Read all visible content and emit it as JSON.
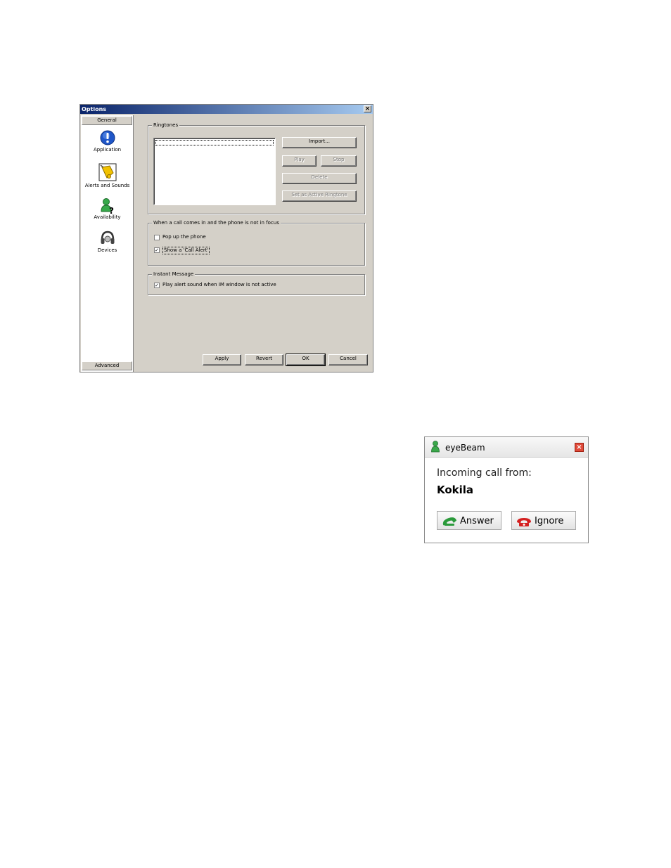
{
  "options": {
    "title": "Options",
    "sidebar": {
      "top_header": "General",
      "bottom_header": "Advanced",
      "items": [
        {
          "label": "Application",
          "icon": "info-icon"
        },
        {
          "label": "Alerts and Sounds",
          "icon": "bell-icon"
        },
        {
          "label": "Availability",
          "icon": "availability-icon"
        },
        {
          "label": "Devices",
          "icon": "headset-icon"
        }
      ]
    },
    "ringtones": {
      "title": "Ringtones",
      "import_label": "Import...",
      "play_label": "Play",
      "stop_label": "Stop",
      "delete_label": "Delete",
      "set_active_label": "Set as Active Ringtone"
    },
    "focus_group": {
      "title": "When a call comes in and the phone is not in focus",
      "popup_label": "Pop up the phone",
      "popup_checked": false,
      "call_alert_label": "Show a 'Call Alert'",
      "call_alert_checked": true
    },
    "im_group": {
      "title": "Instant Message",
      "play_alert_label": "Play alert sound when IM window is not active",
      "play_alert_checked": true
    },
    "footer": {
      "apply": "Apply",
      "revert": "Revert",
      "ok": "OK",
      "cancel": "Cancel"
    }
  },
  "incoming": {
    "app_title": "eyeBeam",
    "prompt": "Incoming call from:",
    "caller": "Kokila",
    "answer_label": "Answer",
    "ignore_label": "Ignore",
    "colors": {
      "answer": "#2a9a3a",
      "ignore": "#d42020"
    }
  }
}
